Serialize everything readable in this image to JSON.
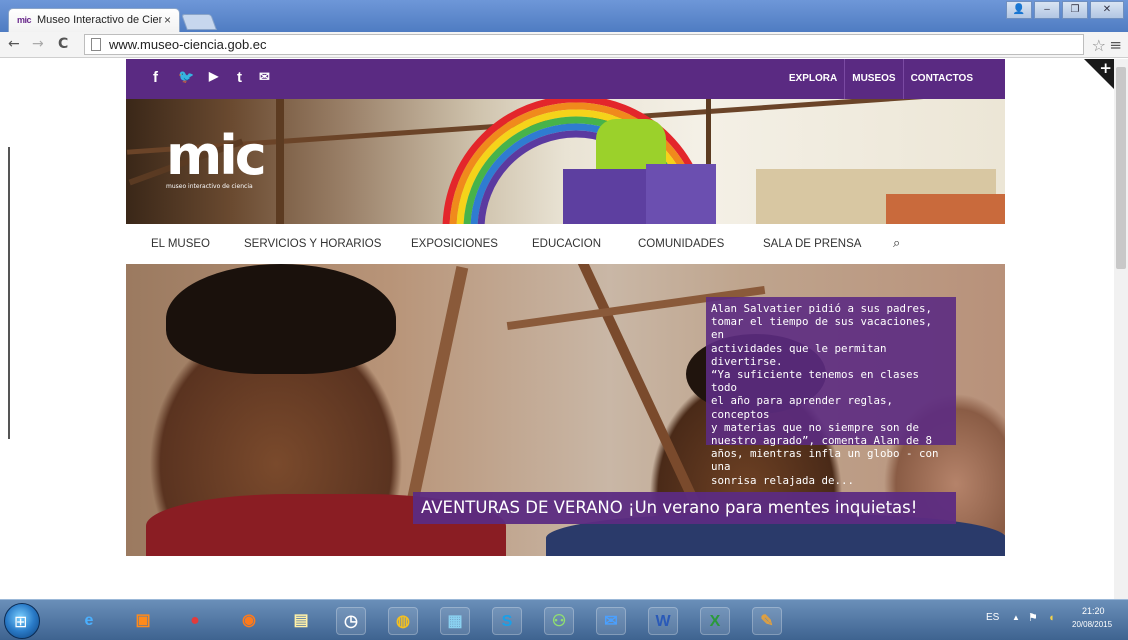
{
  "browser": {
    "tab_favicon": "mic",
    "tab_title": "Museo Interactivo de Cien",
    "tab_close": "×",
    "url": "www.museo-ciencia.gob.ec",
    "back_icon": "←",
    "forward_icon": "→",
    "reload_icon": "C",
    "star_icon": "☆",
    "menu_icon": "≡",
    "win_user": "👤",
    "win_min": "–",
    "win_max": "❐",
    "win_close": "✕"
  },
  "site": {
    "social": {
      "facebook": "f",
      "twitter": "🐦",
      "youtube": "▶",
      "tumblr": "t",
      "email": "✉"
    },
    "topnav": [
      "EXPLORA",
      "MUSEOS",
      "CONTACTOS"
    ],
    "logo": {
      "text": "mic",
      "tagline": "museo interactivo de ciencia"
    },
    "mainnav": [
      "EL MUSEO",
      "SERVICIOS Y HORARIOS",
      "EXPOSICIONES",
      "EDUCACION",
      "COMUNIDADES",
      "SALA DE PRENSA"
    ],
    "search_icon": "⌕",
    "hero": {
      "quote_lines": [
        "Alan Salvatier pidió a sus padres,",
        "tomar el tiempo de sus vacaciones, en",
        "actividades que le permitan divertirse.",
        "“Ya suficiente tenemos en clases todo",
        "el año para aprender reglas, conceptos",
        "y materias que no siempre son de",
        "nuestro agrado”, comenta Alan de 8",
        "años, mientras infla un globo - con una",
        "sonrisa relajada de..."
      ],
      "title": "AVENTURAS DE VERANO ¡Un verano para mentes inquietas!"
    },
    "corner_plus": "+"
  },
  "taskbar": {
    "start_glyph": "⊞",
    "lang": "ES",
    "time": "21:20",
    "date": "20/08/2015",
    "tray_arrow": "▲",
    "tray_flag": "⚑"
  },
  "colors": {
    "brand_purple": "#5a2a82",
    "hero_overlay": "#5c2b82",
    "taskbar": "#3e6390"
  }
}
